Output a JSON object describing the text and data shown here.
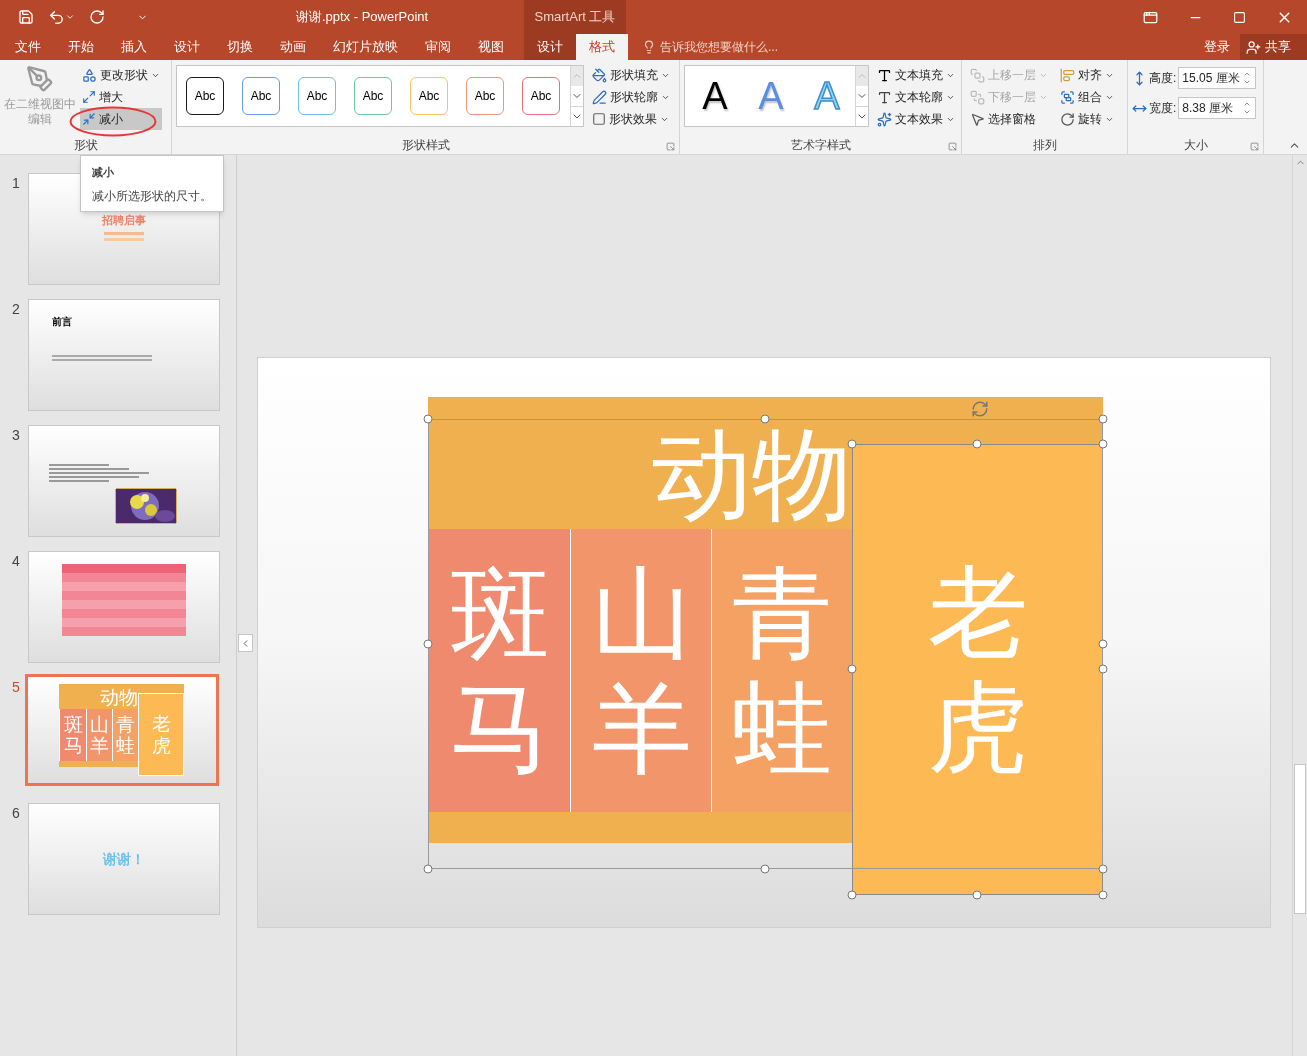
{
  "window": {
    "title": "谢谢.pptx - PowerPoint",
    "context_label": "SmartArt 工具"
  },
  "ribbon_tabs": [
    {
      "label": "文件",
      "selected": false,
      "kind": "normal"
    },
    {
      "label": "开始",
      "selected": false,
      "kind": "normal"
    },
    {
      "label": "插入",
      "selected": false,
      "kind": "normal"
    },
    {
      "label": "设计",
      "selected": false,
      "kind": "normal"
    },
    {
      "label": "切换",
      "selected": false,
      "kind": "normal"
    },
    {
      "label": "动画",
      "selected": false,
      "kind": "normal"
    },
    {
      "label": "幻灯片放映",
      "selected": false,
      "kind": "normal"
    },
    {
      "label": "审阅",
      "selected": false,
      "kind": "normal"
    },
    {
      "label": "视图",
      "selected": false,
      "kind": "normal"
    },
    {
      "label": "设计",
      "selected": false,
      "kind": "context"
    },
    {
      "label": "格式",
      "selected": true,
      "kind": "context"
    }
  ],
  "tell_me": {
    "placeholder": "告诉我您想要做什么..."
  },
  "account": {
    "sign_in": "登录",
    "share": "共享"
  },
  "shape_group": {
    "title": "形状",
    "edit_2d": {
      "label": "在二维视图中编辑",
      "disabled": true
    },
    "commands": [
      {
        "label": "更改形状",
        "dropdown": true,
        "highlighted": false
      },
      {
        "label": "增大",
        "dropdown": false,
        "highlighted": false
      },
      {
        "label": "减小",
        "dropdown": false,
        "highlighted": true
      }
    ]
  },
  "shape_styles": {
    "title": "形状样式",
    "presets": [
      {
        "label": "Abc",
        "color": "#1a1a1a"
      },
      {
        "label": "Abc",
        "color": "#6a9be6"
      },
      {
        "label": "Abc",
        "color": "#6cbfe8"
      },
      {
        "label": "Abc",
        "color": "#6ccb9a"
      },
      {
        "label": "Abc",
        "color": "#f8c466"
      },
      {
        "label": "Abc",
        "color": "#f0937a"
      },
      {
        "label": "Abc",
        "color": "#ec6d7b"
      }
    ],
    "commands": [
      {
        "label": "形状填充",
        "dropdown": true
      },
      {
        "label": "形状轮廓",
        "dropdown": true
      },
      {
        "label": "形状效果",
        "dropdown": true
      }
    ]
  },
  "wordart_styles": {
    "title": "艺术字样式",
    "presets": [
      {
        "label": "A",
        "kind": "fill",
        "color": "#000000"
      },
      {
        "label": "A",
        "kind": "fill",
        "color": "#5b8fdc"
      },
      {
        "label": "A",
        "kind": "outline",
        "color": "#8fd3f4"
      }
    ],
    "commands": [
      {
        "label": "文本填充",
        "dropdown": true
      },
      {
        "label": "文本轮廓",
        "dropdown": true
      },
      {
        "label": "文本效果",
        "dropdown": true
      }
    ]
  },
  "arrange": {
    "title": "排列",
    "commands": [
      {
        "label": "上移一层",
        "dropdown": true,
        "disabled": true
      },
      {
        "label": "对齐",
        "dropdown": true,
        "disabled": false
      },
      {
        "label": "下移一层",
        "dropdown": true,
        "disabled": true
      },
      {
        "label": "组合",
        "dropdown": true,
        "disabled": false
      },
      {
        "label": "选择窗格",
        "dropdown": false,
        "disabled": false
      },
      {
        "label": "旋转",
        "dropdown": true,
        "disabled": false
      }
    ]
  },
  "size": {
    "title": "大小",
    "fields": [
      {
        "label": "高度:",
        "value": "15.05 厘米"
      },
      {
        "label": "宽度:",
        "value": "8.38 厘米"
      }
    ]
  },
  "tooltip": {
    "title": "减小",
    "text": "减小所选形状的尺寸。"
  },
  "slides": [
    {
      "number": "1",
      "selected": false,
      "kind": "title",
      "title": "招聘启事"
    },
    {
      "number": "2",
      "selected": false,
      "kind": "text",
      "title": "前言"
    },
    {
      "number": "3",
      "selected": false,
      "kind": "picture"
    },
    {
      "number": "4",
      "selected": false,
      "kind": "table"
    },
    {
      "number": "5",
      "selected": true,
      "kind": "smartart",
      "heading": "动物",
      "items": [
        {
          "label": "斑马",
          "color": "#ef8a6e"
        },
        {
          "label": "山羊",
          "color": "#f2956a"
        },
        {
          "label": "青蛙",
          "color": "#f4a163"
        },
        {
          "label": "老虎",
          "color": "#fdb954"
        }
      ]
    },
    {
      "number": "6",
      "selected": false,
      "kind": "thanks",
      "title": "谢谢！"
    }
  ],
  "smartart": {
    "heading": "动物",
    "items": [
      {
        "label": "斑马",
        "color": "#ef8a6e"
      },
      {
        "label": "山羊",
        "color": "#f2956a"
      },
      {
        "label": "青蛙",
        "color": "#f4a163"
      },
      {
        "label": "老虎",
        "color": "#fdb954"
      }
    ]
  }
}
